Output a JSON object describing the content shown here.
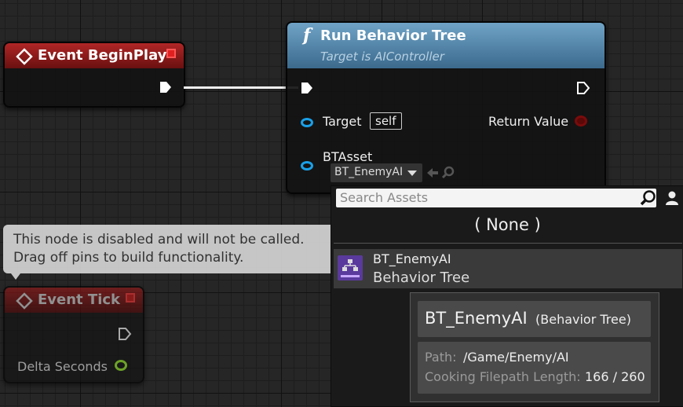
{
  "event_begin_play": {
    "title": "Event BeginPlay"
  },
  "run_behavior_tree": {
    "title": "Run Behavior Tree",
    "subtitle": "Target is AIController",
    "function_glyph": "f",
    "pins": {
      "target_label": "Target",
      "target_value": "self",
      "return_value_label": "Return Value",
      "bt_asset_label": "BTAsset",
      "bt_asset_value": "BT_EnemyAI"
    }
  },
  "disabled_comment": {
    "line1": "This node is disabled and will not be called.",
    "line2": "Drag off pins to build functionality."
  },
  "event_tick": {
    "title": "Event Tick",
    "pin_label": "Delta Seconds"
  },
  "asset_picker": {
    "search_placeholder": "Search Assets",
    "none_option": "( None )",
    "items": [
      {
        "name": "BT_EnemyAI",
        "type": "Behavior Tree"
      }
    ]
  },
  "tooltip": {
    "name": "BT_EnemyAI",
    "type": "(Behavior Tree)",
    "path_label": "Path:",
    "path_value": "/Game/Enemy/AI",
    "cooking_label": "Cooking Filepath Length:",
    "cooking_value": "166 / 260"
  },
  "colors": {
    "event_header": "#8b1b1b",
    "function_header": "#5a8fb4",
    "object_pin": "#1aa0e8",
    "return_pin": "#7a0b0b",
    "float_pin": "#8ad32a"
  }
}
